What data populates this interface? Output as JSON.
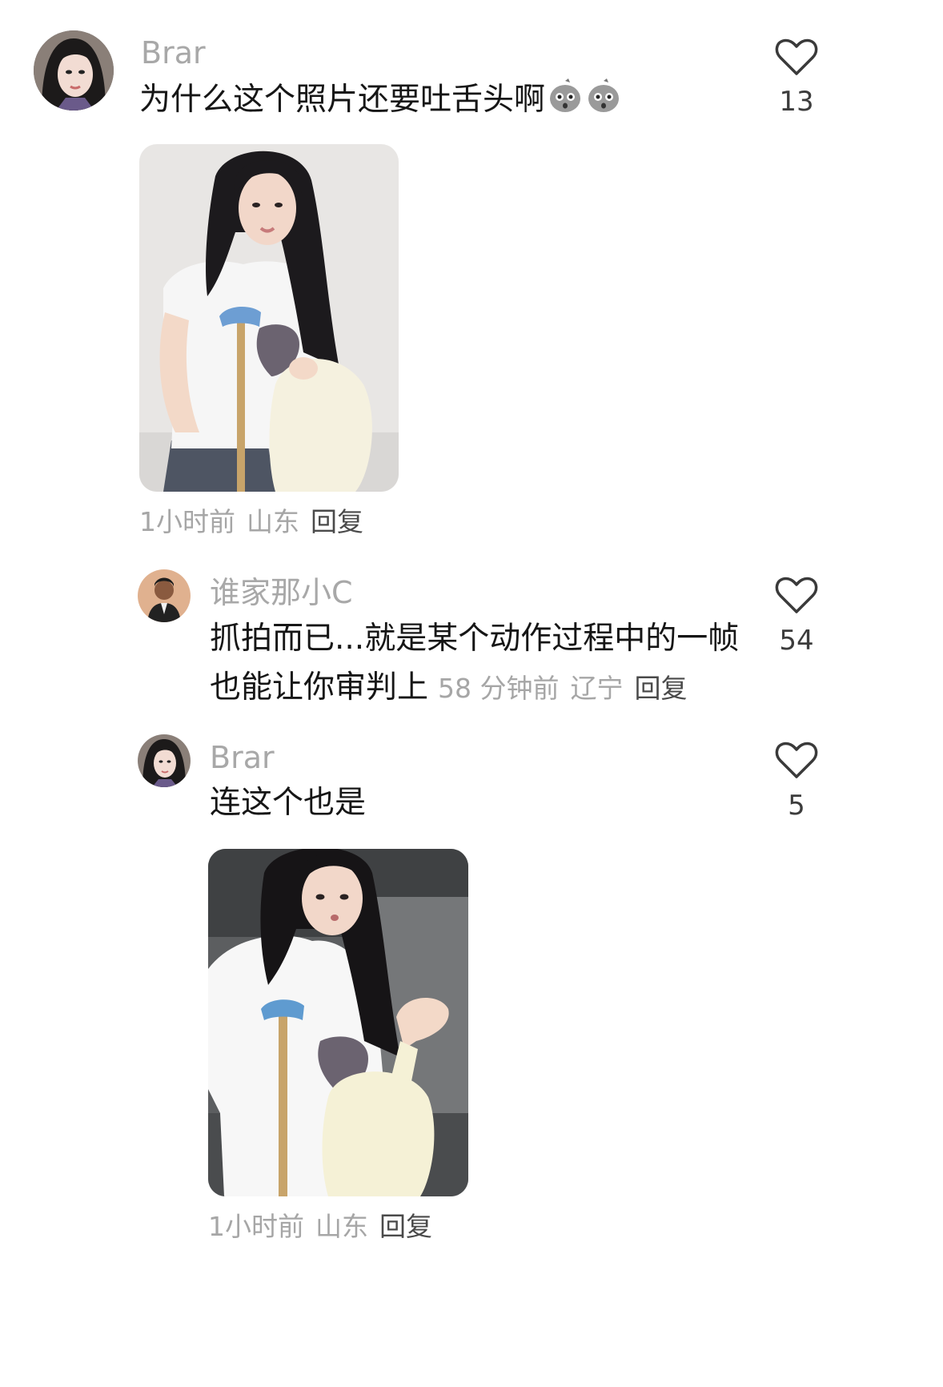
{
  "comments": [
    {
      "username": "Brar",
      "text": "为什么这个照片还要吐舌头啊",
      "emojis": [
        "shocked-face-emoji",
        "shocked-face-emoji"
      ],
      "likes": "13",
      "time": "1小时前",
      "location": "山东",
      "reply": "回复",
      "has_image": true
    },
    {
      "username": "谁家那小C",
      "text_line1": "抓拍而已...就是某个动作过程中的一帧",
      "text_line2": "也能让你审判上",
      "likes": "54",
      "time": "58 分钟前",
      "location": "辽宁",
      "reply": "回复"
    },
    {
      "username": "Brar",
      "text": "连这个也是",
      "likes": "5",
      "time": "1小时前",
      "location": "山东",
      "reply": "回复",
      "has_image": true
    }
  ],
  "colors": {
    "username": "#a8a8a8",
    "text": "#161616",
    "meta": "#a6a6a6",
    "reply": "#4a4a4a"
  }
}
